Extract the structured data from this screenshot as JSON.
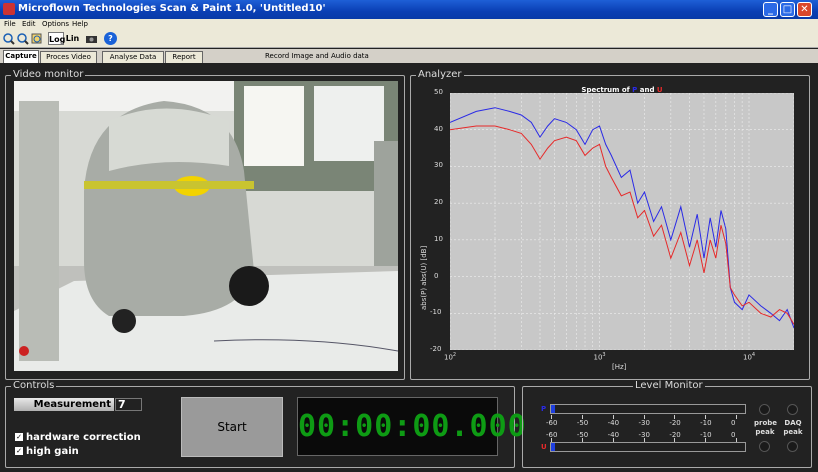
{
  "window": {
    "title": "Microflown Technologies Scan & Paint 1.0, 'Untitled10'",
    "buttons": {
      "minimize": "_",
      "maximize": "□",
      "close": "✕"
    }
  },
  "menu": [
    "File",
    "Edit",
    "Options",
    "Help"
  ],
  "toolbar": {
    "log_label": "Log",
    "lin_label": "Lin",
    "help_label": "?"
  },
  "tabs": [
    {
      "label": "Capture",
      "active": true
    },
    {
      "label": "Proces Video",
      "active": false
    },
    {
      "label": "Analyse Data",
      "active": false
    },
    {
      "label": "Report",
      "active": false
    }
  ],
  "record_info": "Record Image and Audio data",
  "video_monitor": {
    "label": "Video monitor"
  },
  "analyzer": {
    "label": "Analyzer",
    "title_parts": [
      "Spectrum  of ",
      "P",
      " and ",
      "U"
    ],
    "colors": {
      "P": "#2a2ae6",
      "U": "#e62a2a",
      "background": "#c8c8c8"
    }
  },
  "chart_data": {
    "type": "line",
    "title": "Spectrum  of P and U",
    "xlabel": "[Hz]",
    "ylabel": "abs(P) abs(U) [dB]",
    "xscale": "log",
    "xlim": [
      100,
      20000
    ],
    "ylim": [
      -20,
      50
    ],
    "xticks": [
      "10^2",
      "10^3",
      "10^4"
    ],
    "yticks": [
      -20,
      -10,
      0,
      10,
      20,
      30,
      40,
      50
    ],
    "grid": true,
    "series": [
      {
        "name": "P",
        "color": "#2a2ae6",
        "x": [
          100,
          150,
          200,
          250,
          300,
          350,
          400,
          450,
          500,
          600,
          700,
          800,
          900,
          1000,
          1100,
          1200,
          1400,
          1600,
          1800,
          2000,
          2300,
          2600,
          3000,
          3500,
          4000,
          4500,
          5000,
          5500,
          6000,
          6500,
          7000,
          7500,
          8000,
          9000,
          10000,
          12000,
          14000,
          16000,
          18000,
          20000
        ],
        "y": [
          42,
          45,
          46,
          45,
          44,
          42,
          38,
          41,
          43,
          42,
          40,
          36,
          40,
          41,
          36,
          33,
          27,
          29,
          20,
          23,
          15,
          19,
          10,
          19,
          8,
          17,
          5,
          16,
          8,
          18,
          13,
          -3,
          -7,
          -9,
          -5,
          -8,
          -10,
          -12,
          -9,
          -14
        ]
      },
      {
        "name": "U",
        "color": "#e62a2a",
        "x": [
          100,
          150,
          200,
          250,
          300,
          350,
          400,
          450,
          500,
          600,
          700,
          800,
          900,
          1000,
          1100,
          1200,
          1400,
          1600,
          1800,
          2000,
          2300,
          2600,
          3000,
          3500,
          4000,
          4500,
          5000,
          5500,
          6000,
          6500,
          7000,
          7500,
          8000,
          9000,
          10000,
          12000,
          14000,
          16000,
          18000,
          20000
        ],
        "y": [
          40,
          41,
          41,
          40,
          39,
          36,
          32,
          35,
          37,
          38,
          37,
          33,
          35,
          36,
          30,
          27,
          22,
          23,
          16,
          18,
          11,
          14,
          5,
          12,
          3,
          10,
          1,
          10,
          5,
          14,
          9,
          -3,
          -5,
          -8,
          -7,
          -10,
          -11,
          -9,
          -10,
          -13
        ]
      }
    ]
  },
  "controls": {
    "label": "Controls",
    "measurement_label": "Measurement",
    "measurement_value": "7",
    "hardware_correction": "hardware correction",
    "high_gain": "high gain",
    "check_mark": "✓",
    "start_label": "Start",
    "timer": "00:00:00.000"
  },
  "level_monitor": {
    "label": "Level Monitor",
    "p_label": "P",
    "u_label": "U",
    "scale": [
      "-60",
      "-50",
      "-40",
      "-30",
      "-20",
      "-10",
      "0"
    ],
    "probe_peak": [
      "probe",
      "peak"
    ],
    "daq_peak": [
      "DAQ",
      "peak"
    ],
    "p_level": 0.02,
    "u_level": 0.02
  }
}
